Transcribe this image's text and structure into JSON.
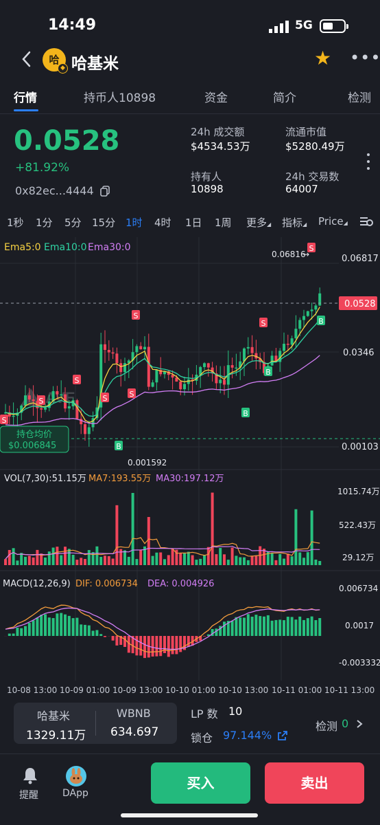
{
  "status_bar": {
    "time": "14:49",
    "network": "5G"
  },
  "header": {
    "avatar_text": "哈",
    "token_name": "哈基米"
  },
  "tabs": [
    "行情",
    "持币人10898",
    "资金",
    "简介",
    "检测"
  ],
  "price": {
    "value": "0.0528",
    "change": "+81.92%",
    "address": "0x82ec...4444"
  },
  "stats": [
    {
      "label": "24h 成交额",
      "value": "$4534.53万"
    },
    {
      "label": "流通市值",
      "value": "$5280.49万"
    },
    {
      "label": "持有人",
      "value": "10898"
    },
    {
      "label": "24h 交易数",
      "value": "64007"
    }
  ],
  "timeframes": [
    "1秒",
    "1分",
    "5分",
    "15分",
    "1时",
    "4时",
    "1日",
    "1周",
    "更多",
    "指标",
    "Price"
  ],
  "active_timeframe": "1时",
  "chart": {
    "ema_legend": [
      "Ema5:0",
      "Ema10:0",
      "Ema30:0"
    ],
    "price_axis": [
      "0.06817",
      "0.0346",
      "0.00103"
    ],
    "current_price_tag": "0.0528",
    "high_label": "0.06816",
    "low_label": "0.001592",
    "avg_cost_label": "持仓均价",
    "avg_cost_value": "$0.006845",
    "vol_legend": [
      "VOL(7,30):51.15万",
      "MA7:193.55万",
      "MA30:197.12万"
    ],
    "vol_axis": [
      "1015.74万",
      "522.43万",
      "29.12万"
    ],
    "macd_legend": [
      "MACD(12,26,9)",
      "DIF: 0.006734",
      "DEA: 0.004926"
    ],
    "macd_axis": [
      "0.006734",
      "0.0017",
      "-0.003332"
    ],
    "time_labels": [
      "10-08 13:00",
      "10-09 01:00",
      "10-09 13:00",
      "10-10 01:00",
      "10-10 13:00",
      "10-11 01:00",
      "10-11 13:00"
    ],
    "sell_marker": "S",
    "buy_marker": "B"
  },
  "chart_data": {
    "type": "candlestick",
    "ylim": [
      0.00103,
      0.06817
    ],
    "last_price": 0.0528,
    "high": 0.06816,
    "low": 0.001592,
    "avg_cost": 0.006845,
    "volume_axis_ticks": [
      29.12,
      522.43,
      1015.74
    ],
    "macd_axis_ticks": [
      -0.003332,
      0.0017,
      0.006734
    ],
    "dif": 0.006734,
    "dea": 0.004926,
    "vol": 51.15,
    "vol_ma7": 193.55,
    "vol_ma30": 197.12
  },
  "pool": {
    "token_label": "哈基米",
    "token_amount": "1329.11万",
    "base_label": "WBNB",
    "base_amount": "634.697"
  },
  "lp": {
    "label": "LP 数",
    "value": "10"
  },
  "lock": {
    "label": "锁仓",
    "value": "97.144%"
  },
  "detect": {
    "label": "检测",
    "value": "0"
  },
  "bottom": {
    "alert_label": "提醒",
    "dapp_label": "DApp",
    "buy_label": "买入",
    "sell_label": "卖出"
  },
  "colors": {
    "up": "#27c17f",
    "down": "#f0455a",
    "accent": "#2b7ef6",
    "ema5": "#f5d142",
    "ema10": "#2fd3a3",
    "ema30": "#d27ef5"
  }
}
